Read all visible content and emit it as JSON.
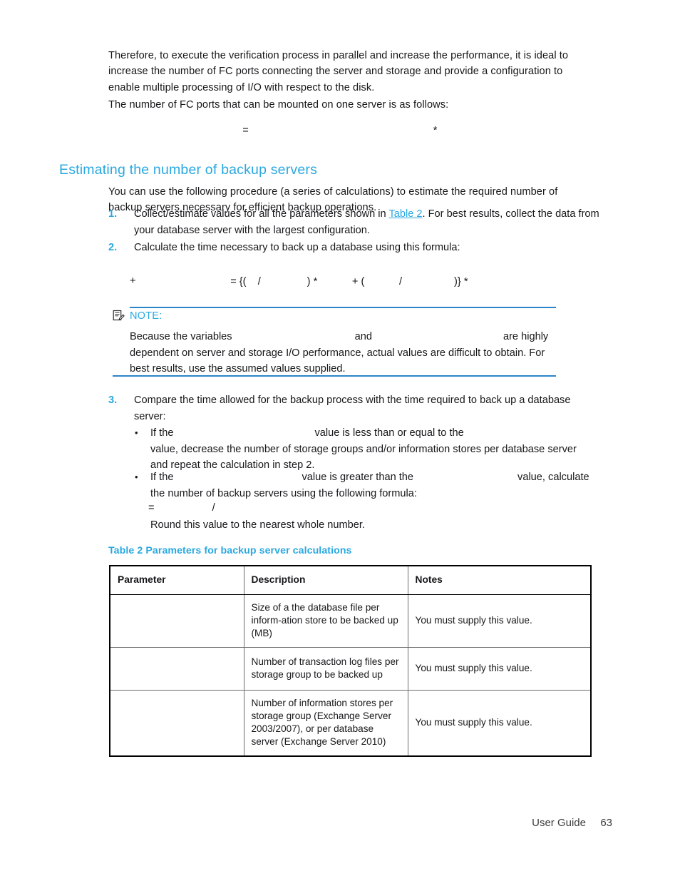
{
  "page": {
    "intro_paragraph_1": "Therefore, to execute the verification process in parallel and increase the performance, it is ideal to increase the number of FC ports connecting the server and storage and provide a configuration to enable multiple processing of I/O with respect to the disk.",
    "intro_paragraph_2": "The number of FC ports that can be mounted on one server is as follows:"
  },
  "formulas": {
    "fc_ports": {
      "equals_sign": "=",
      "asterisk": "*"
    },
    "backup_time": {
      "line1_symbols": "= {(    /                ) *            + (            /                  )} *",
      "line2_symbols": "+"
    },
    "backup_servers": {
      "symbols": "=                    /"
    }
  },
  "section": {
    "heading": "Estimating the number of backup servers",
    "lead_paragraph": "You can use the following procedure (a series of calculations) to estimate the required number of backup servers necessary for efficient backup operations."
  },
  "steps": [
    {
      "number": "1.",
      "text_before_link": "Collect/estimate values for all the parameters shown in ",
      "link": "Table 2",
      "text_after_link": ". For best results, collect the data from your database server with the largest configuration."
    },
    {
      "number": "2.",
      "text": "Calculate the time necessary to back up a database using this formula:"
    },
    {
      "number": "3.",
      "text": "Compare the time allowed for the backup process with the time required to back up a database server:"
    }
  ],
  "bullets": [
    {
      "marker": "•",
      "part1": "If the",
      "part2": "value is less than or equal to the",
      "part3": "value, decrease the number of storage groups and/or information stores per database server and repeat the calculation in step 2."
    },
    {
      "marker": "•",
      "part1": "If the",
      "part2": "value is greater than the",
      "part3": "value, calculate the number of backup servers using the following formula:"
    }
  ],
  "round_note": "Round this value to the nearest whole number.",
  "note": {
    "icon": "note-document-pencil-icon",
    "label": "NOTE:",
    "text_part1": "Because the variables",
    "text_part2": "and",
    "text_part3": "are highly dependent on server and storage I/O performance, actual values are difficult to obtain. For best results, use the assumed values supplied."
  },
  "table": {
    "caption_label": "Table 2",
    "caption_title": "Parameters for backup server calculations",
    "headers": [
      "Parameter",
      "Description",
      "Notes"
    ],
    "rows": [
      {
        "parameter": "",
        "description": "Size of a the database file per inform-ation store to be backed up (MB)",
        "notes": "You must supply this value."
      },
      {
        "parameter": "",
        "description": "Number of transaction log files per storage group to be backed up",
        "notes": "You must supply this value."
      },
      {
        "parameter": "",
        "description": "Number of information stores per storage group (Exchange Server 2003/2007), or per database server (Exchange Server 2010)",
        "notes": "You must supply this value."
      }
    ]
  },
  "footer": {
    "guide_label": "User Guide",
    "page_number": "63"
  },
  "colors": {
    "accent_cyan": "#2aa8e0",
    "note_rule": "#2a86c8",
    "body_text": "#17171a",
    "table_border": "#6d6d6d",
    "table_frame": "#000000"
  }
}
